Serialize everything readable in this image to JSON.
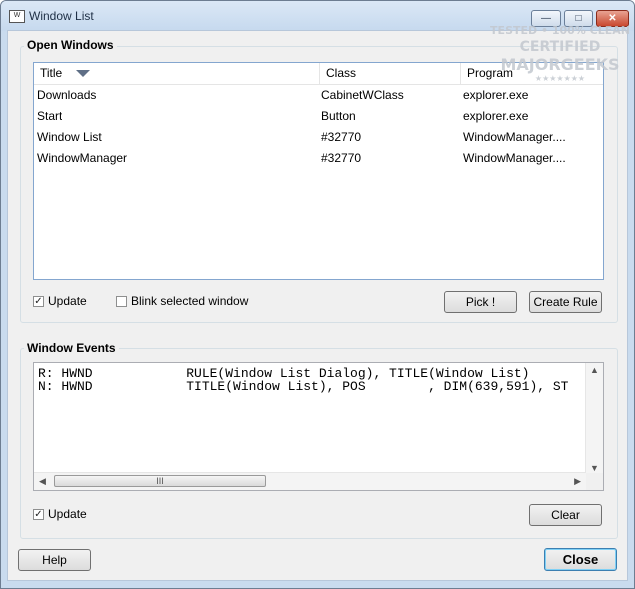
{
  "window": {
    "title": "Window List",
    "app_icon_glyph": "W"
  },
  "caption_buttons": {
    "minimize_glyph": "—",
    "maximize_glyph": "□",
    "close_glyph": "✕"
  },
  "open_windows": {
    "label": "Open Windows",
    "columns": {
      "title": "Title",
      "class": "Class",
      "program": "Program"
    },
    "rows": [
      {
        "title": "Downloads",
        "class": "CabinetWClass",
        "program": "explorer.exe"
      },
      {
        "title": "Start",
        "class": "Button",
        "program": "explorer.exe"
      },
      {
        "title": "Window List",
        "class": "#32770",
        "program": "WindowManager...."
      },
      {
        "title": "WindowManager",
        "class": "#32770",
        "program": "WindowManager...."
      }
    ],
    "update_label": "Update",
    "update_checked": true,
    "blink_label": "Blink selected window",
    "blink_checked": false,
    "pick_label": "Pick !",
    "create_rule_label": "Create Rule"
  },
  "window_events": {
    "label": "Window Events",
    "lines": [
      "R: HWND            RULE(Window List Dialog), TITLE(Window List)",
      "N: HWND            TITLE(Window List), POS        , DIM(639,591), ST"
    ],
    "scroll_thumb_glyph": "III",
    "update_label": "Update",
    "update_checked": true,
    "clear_label": "Clear"
  },
  "footer": {
    "help_label": "Help",
    "close_label": "Close"
  },
  "watermark": {
    "line1": "TESTED • 100% CLEAN",
    "line2": "CERTIFIED",
    "line3": "MAJORGEEKS",
    "line4": "★★★★★★★"
  }
}
